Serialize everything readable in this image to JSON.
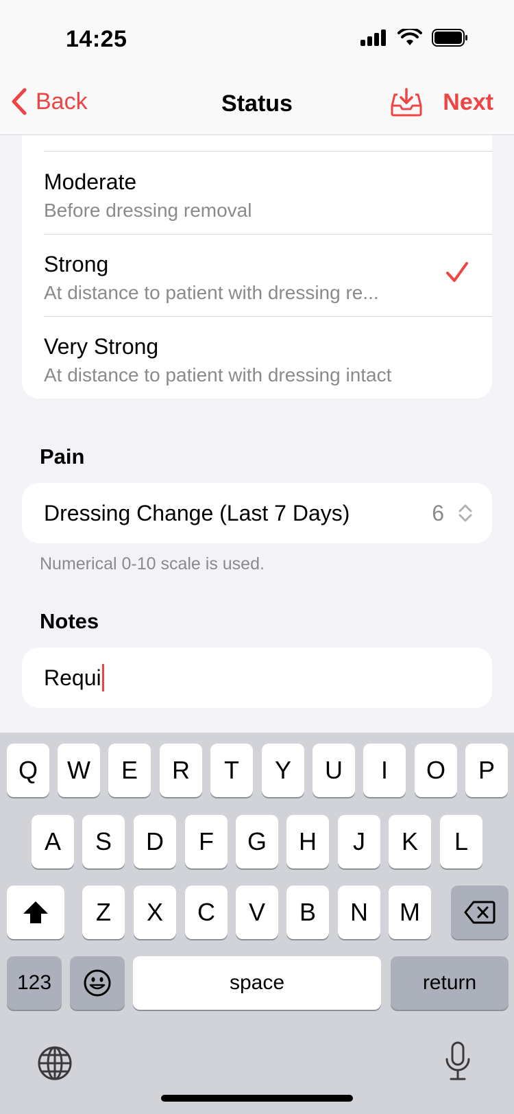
{
  "status_bar": {
    "time": "14:25"
  },
  "nav": {
    "back_label": "Back",
    "title": "Status",
    "next_label": "Next",
    "accent": "#ef4444"
  },
  "odor": {
    "options": [
      {
        "title": "Moderate",
        "subtitle": "Before dressing removal",
        "selected": false
      },
      {
        "title": "Strong",
        "subtitle": "At distance to patient with dressing re...",
        "selected": true
      },
      {
        "title": "Very Strong",
        "subtitle": "At distance to patient with dressing intact",
        "selected": false
      }
    ]
  },
  "pain": {
    "header": "Pain",
    "label": "Dressing Change (Last 7 Days)",
    "value": "6",
    "footnote": "Numerical 0-10 scale is used."
  },
  "notes": {
    "header": "Notes",
    "value": "Requi"
  },
  "keyboard": {
    "row1": [
      "Q",
      "W",
      "E",
      "R",
      "T",
      "Y",
      "U",
      "I",
      "O",
      "P"
    ],
    "row2": [
      "A",
      "S",
      "D",
      "F",
      "G",
      "H",
      "J",
      "K",
      "L"
    ],
    "row3": [
      "Z",
      "X",
      "C",
      "V",
      "B",
      "N",
      "M"
    ],
    "numbers_label": "123",
    "space_label": "space",
    "return_label": "return"
  }
}
